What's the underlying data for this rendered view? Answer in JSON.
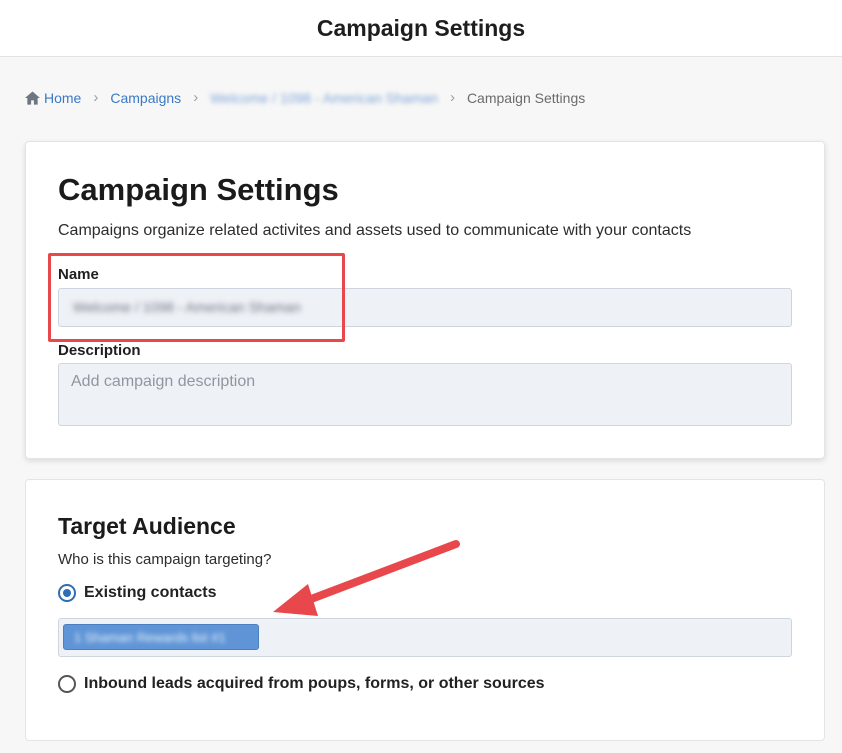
{
  "header": {
    "title": "Campaign Settings"
  },
  "breadcrumb": {
    "home": "Home",
    "campaigns": "Campaigns",
    "campaign_name": "Welcome / 1098 - American Shaman",
    "current": "Campaign Settings"
  },
  "settings_card": {
    "title": "Campaign Settings",
    "subtitle": "Campaigns organize related activites and assets used to communicate with your contacts",
    "name_label": "Name",
    "name_value": "Welcome / 1098 - American Shaman",
    "description_label": "Description",
    "description_placeholder": "Add campaign description"
  },
  "audience_card": {
    "title": "Target Audience",
    "question": "Who is this campaign targeting?",
    "option_existing": "Existing contacts",
    "selected_list": "1 Shaman Rewards list #1",
    "option_inbound": "Inbound leads acquired from poups, forms, or other sources"
  },
  "annotations": {
    "highlight_color": "#e8474b",
    "arrow_color": "#e8474b"
  }
}
